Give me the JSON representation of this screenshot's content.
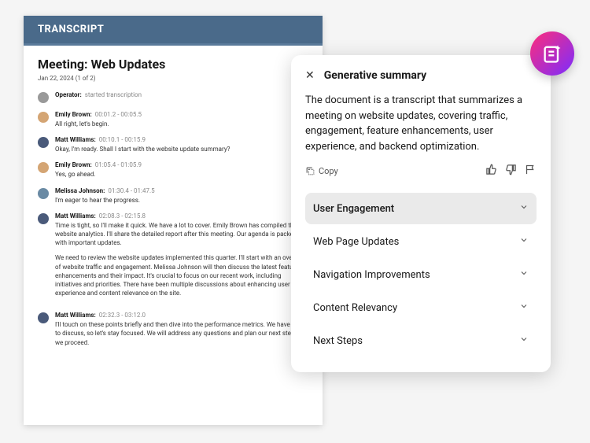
{
  "transcript": {
    "header": "TRANSCRIPT",
    "title": "Meeting: Web Updates",
    "date": "Jan 22, 2024 (1 of 2)",
    "entries": [
      {
        "speaker": "Operator:",
        "timestamp": "started transcription",
        "text": ""
      },
      {
        "speaker": "Emily Brown:",
        "timestamp": "00:01.2 - 00:05.5",
        "text": "All right, let's begin."
      },
      {
        "speaker": "Matt Williams:",
        "timestamp": "00:10.1 - 00:15.9",
        "text": "Okay, I'm ready. Shall I start with the website update summary?"
      },
      {
        "speaker": "Emily Brown:",
        "timestamp": "01:05.4 - 01:05.9",
        "text": "Yes, go ahead."
      },
      {
        "speaker": "Melissa Johnson:",
        "timestamp": "01:30.4 - 01:47.5",
        "text": "I'm eager to hear the progress."
      },
      {
        "speaker": "Matt Williams:",
        "timestamp": "02:08.3 - 02:15.8",
        "text_p1": "Time is tight, so I'll make it quick. We have a lot to cover. Emily Brown has compiled the website analytics. I'll share the detailed report after this meeting. Our agenda is packed with important updates.",
        "text_p2": "We need to review the website updates implemented this quarter. I'll start with an overview of website traffic and engagement. Melissa Johnson will then discuss the latest feature enhancements and their impact. It's crucial to focus on our recent work, including initiatives and priorities. There have been multiple discussions about enhancing user experience and content relevance on the site."
      },
      {
        "speaker": "Matt Williams:",
        "timestamp": "02:32.3 - 03:12.0",
        "text": "I'll touch on these points briefly and then dive into the performance metrics. We have a lot to discuss, so let's stay focused. We will address any questions and plan our next steps as we proceed."
      }
    ]
  },
  "summary": {
    "title": "Generative summary",
    "text": "The document is a transcript that summarizes a meeting on website updates, covering traffic, engagement, feature enhancements, user experience, and backend optimization.",
    "copy_label": "Copy",
    "sections": [
      {
        "label": "User Engagement",
        "active": true
      },
      {
        "label": "Web Page Updates",
        "active": false
      },
      {
        "label": "Navigation Improvements",
        "active": false
      },
      {
        "label": "Content Relevancy",
        "active": false
      },
      {
        "label": "Next Steps",
        "active": false
      }
    ]
  }
}
